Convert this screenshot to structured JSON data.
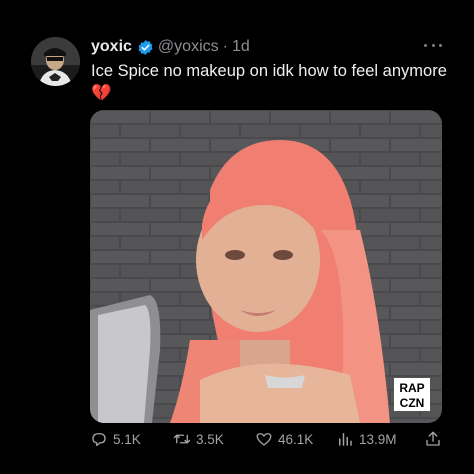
{
  "tweet": {
    "display_name": "yoxic",
    "handle": "@yoxics",
    "separator": "·",
    "time": "1d",
    "text": "Ice Spice no makeup on idk how to feel anymore 💔"
  },
  "media": {
    "watermark_line1": "RAP",
    "watermark_line2": "CZN"
  },
  "actions": {
    "replies": "5.1K",
    "retweets": "3.5K",
    "likes": "46.1K",
    "views": "13.9M"
  },
  "colors": {
    "background": "#000000",
    "verified": "#1d9bf0",
    "secondary_text": "#8b8f94"
  },
  "icons": [
    "verified-badge-icon",
    "more-icon",
    "reply-icon",
    "retweet-icon",
    "like-icon",
    "views-icon",
    "share-icon"
  ]
}
